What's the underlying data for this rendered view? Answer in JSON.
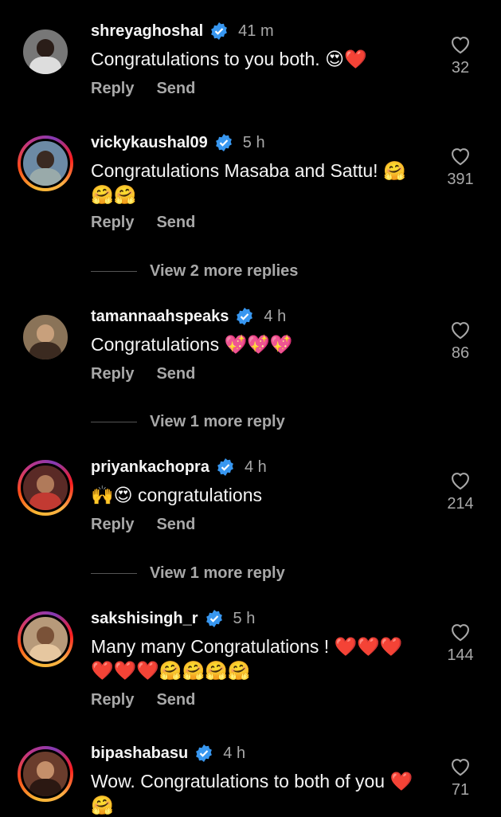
{
  "actions": {
    "reply": "Reply",
    "send": "Send"
  },
  "comments": [
    {
      "username": "shreyaghoshal",
      "time": "41 m",
      "text": "Congratulations to you both. 😍❤️",
      "likes": "32",
      "ring": false
    },
    {
      "username": "vickykaushal09",
      "time": "5 h",
      "text": "Congratulations Masaba and Sattu! 🤗🤗🤗",
      "likes": "391",
      "ring": true
    },
    {
      "username": "tamannaahspeaks",
      "time": "4 h",
      "text": "Congratulations 💖💖💖",
      "likes": "86",
      "ring": false
    },
    {
      "username": "priyankachopra",
      "time": "4 h",
      "text": "🙌😍 congratulations",
      "likes": "214",
      "ring": true
    },
    {
      "username": "sakshisingh_r",
      "time": "5 h",
      "text": "Many many Congratulations ! ❤️❤️❤️❤️❤️❤️🤗🤗🤗🤗",
      "likes": "144",
      "ring": true
    },
    {
      "username": "bipashabasu",
      "time": "4 h",
      "text": "Wow. Congratulations to both of you ❤️🤗",
      "likes": "71",
      "ring": true
    }
  ],
  "view_more": [
    {
      "label": "View 2 more replies"
    },
    {
      "label": "View 1 more reply"
    },
    {
      "label": "View 1 more reply"
    }
  ],
  "colors": {
    "background": "#000000",
    "verified": "#3897f0",
    "muted": "#a8a8a8"
  }
}
